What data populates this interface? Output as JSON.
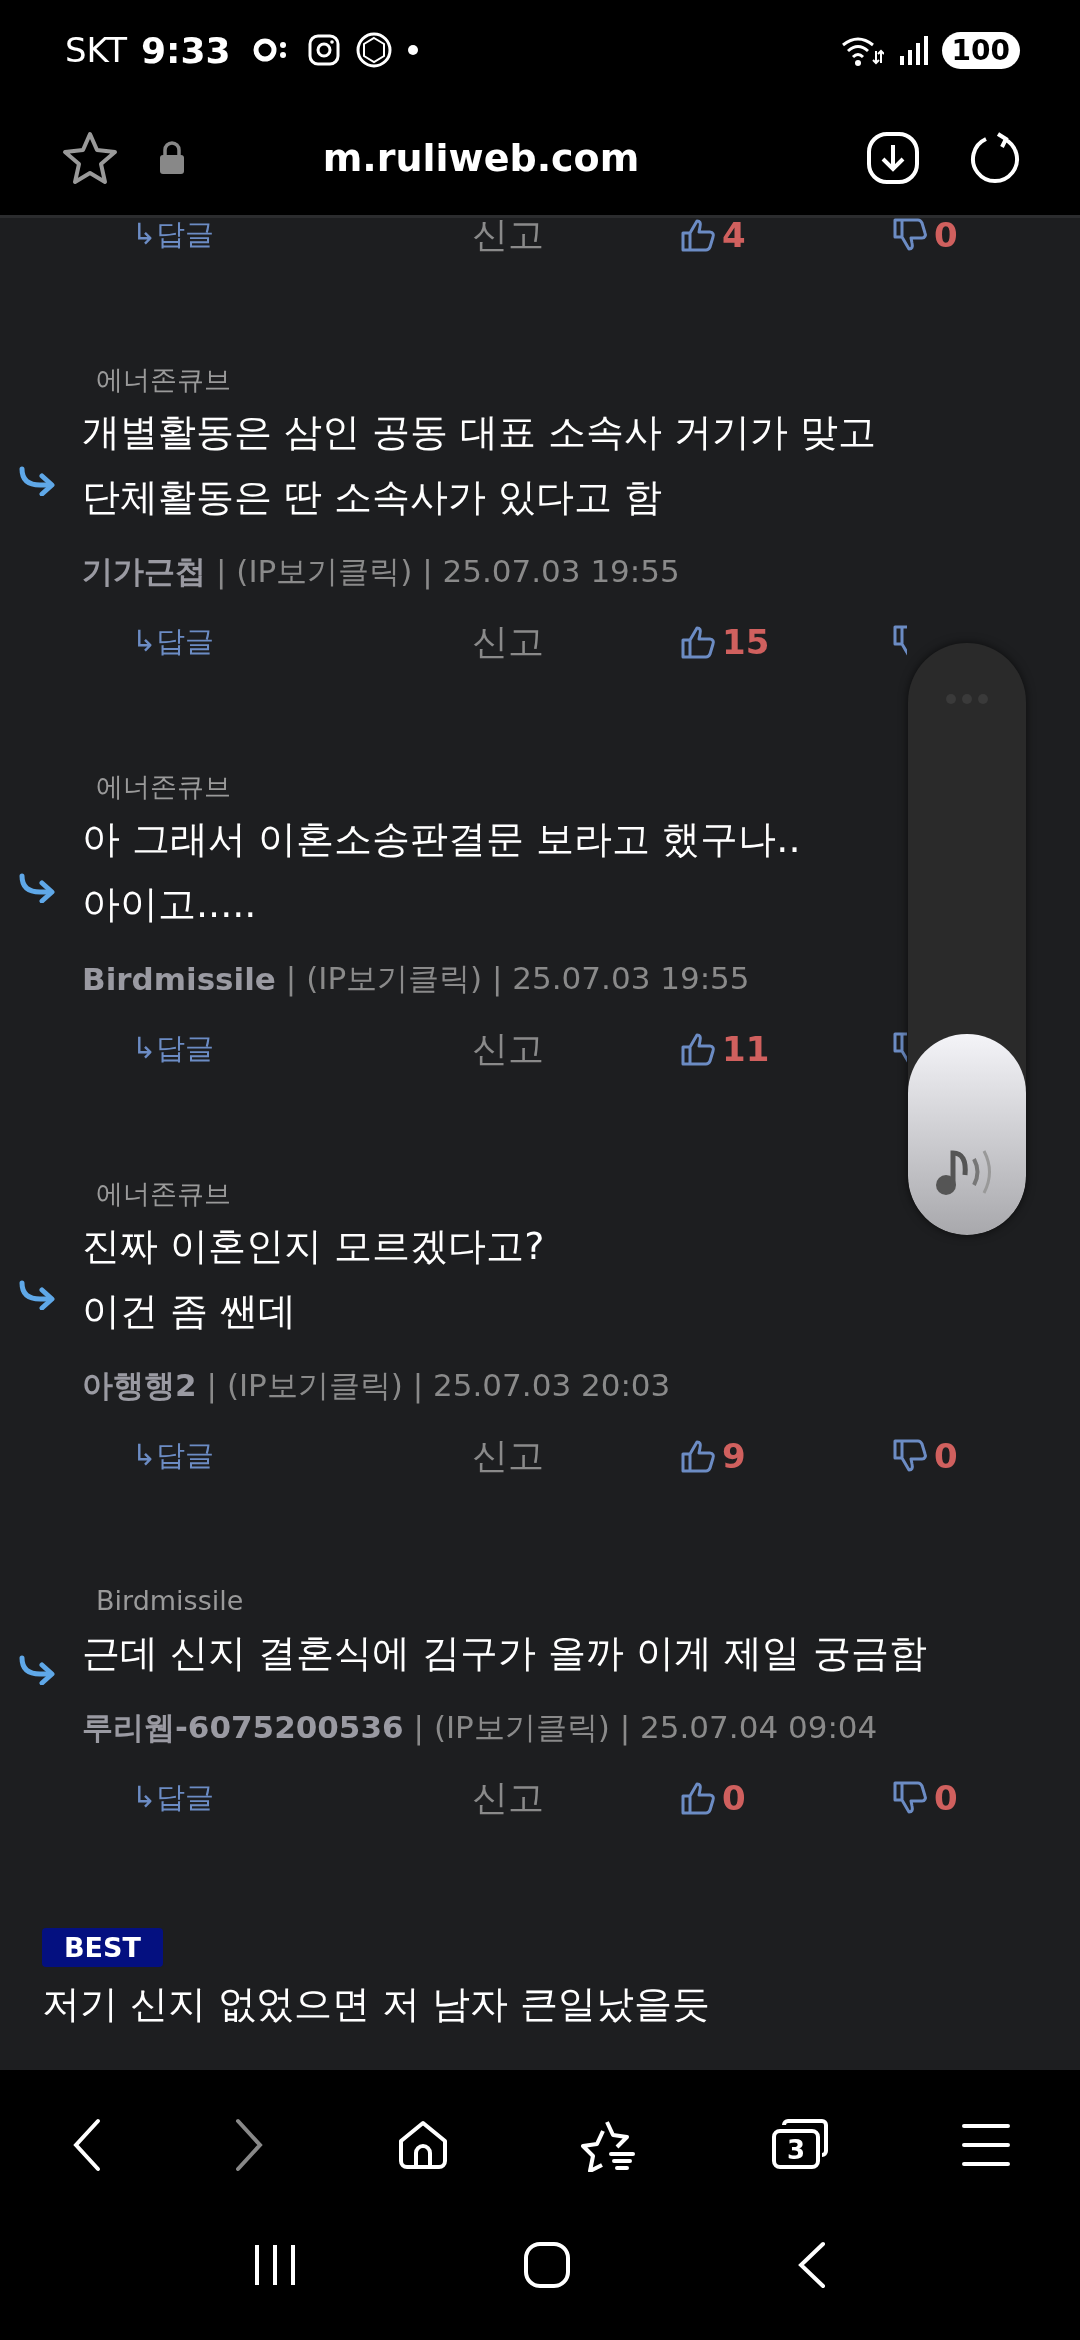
{
  "status_bar": {
    "carrier": "SKT",
    "time": "9:33",
    "battery": "100"
  },
  "address_bar": {
    "url": "m.ruliweb.com"
  },
  "top_actions": {
    "reply": "↳답글",
    "report": "신고",
    "likes": "4",
    "dislikes": "0"
  },
  "comments": [
    {
      "parent": "에너존큐브",
      "lines": [
        "개별활동은 삼인 공동 대표 소속사 거기가 맞고",
        "단체활동은 딴 소속사가 있다고 함"
      ],
      "author": "기가근첩",
      "info": "| (IP보기클릭) | 25.07.03 19:55",
      "reply": "↳답글",
      "report": "신고",
      "likes": "15"
    },
    {
      "parent": "에너존큐브",
      "lines": [
        "아 그래서 이혼소송판결문 보라고 했구나..",
        "아이고....."
      ],
      "author": "Birdmissile",
      "info": "| (IP보기클릭) | 25.07.03 19:55",
      "reply": "↳답글",
      "report": "신고",
      "likes": "11"
    },
    {
      "parent": "에너존큐브",
      "lines": [
        "진짜 이혼인지 모르겠다고?",
        "이건 좀 쌘데"
      ],
      "author": "아행행2",
      "info": "| (IP보기클릭) | 25.07.03 20:03",
      "reply": "↳답글",
      "report": "신고",
      "likes": "9",
      "dislikes": "0"
    },
    {
      "parent": "Birdmissile",
      "lines": [
        "근데 신지 결혼식에 김구가 올까 이게 제일 궁금함"
      ],
      "author": "루리웹-6075200536",
      "info": "| (IP보기클릭) | 25.07.04 09:04",
      "reply": "↳답글",
      "report": "신고",
      "likes": "0",
      "dislikes": "0"
    }
  ],
  "best": {
    "badge": "BEST",
    "title": "저기 신지 없었으면 저 남자 큰일났을듯"
  },
  "volume": {
    "level": 0.34
  },
  "bottom_nav": {
    "tab_count": "3"
  }
}
